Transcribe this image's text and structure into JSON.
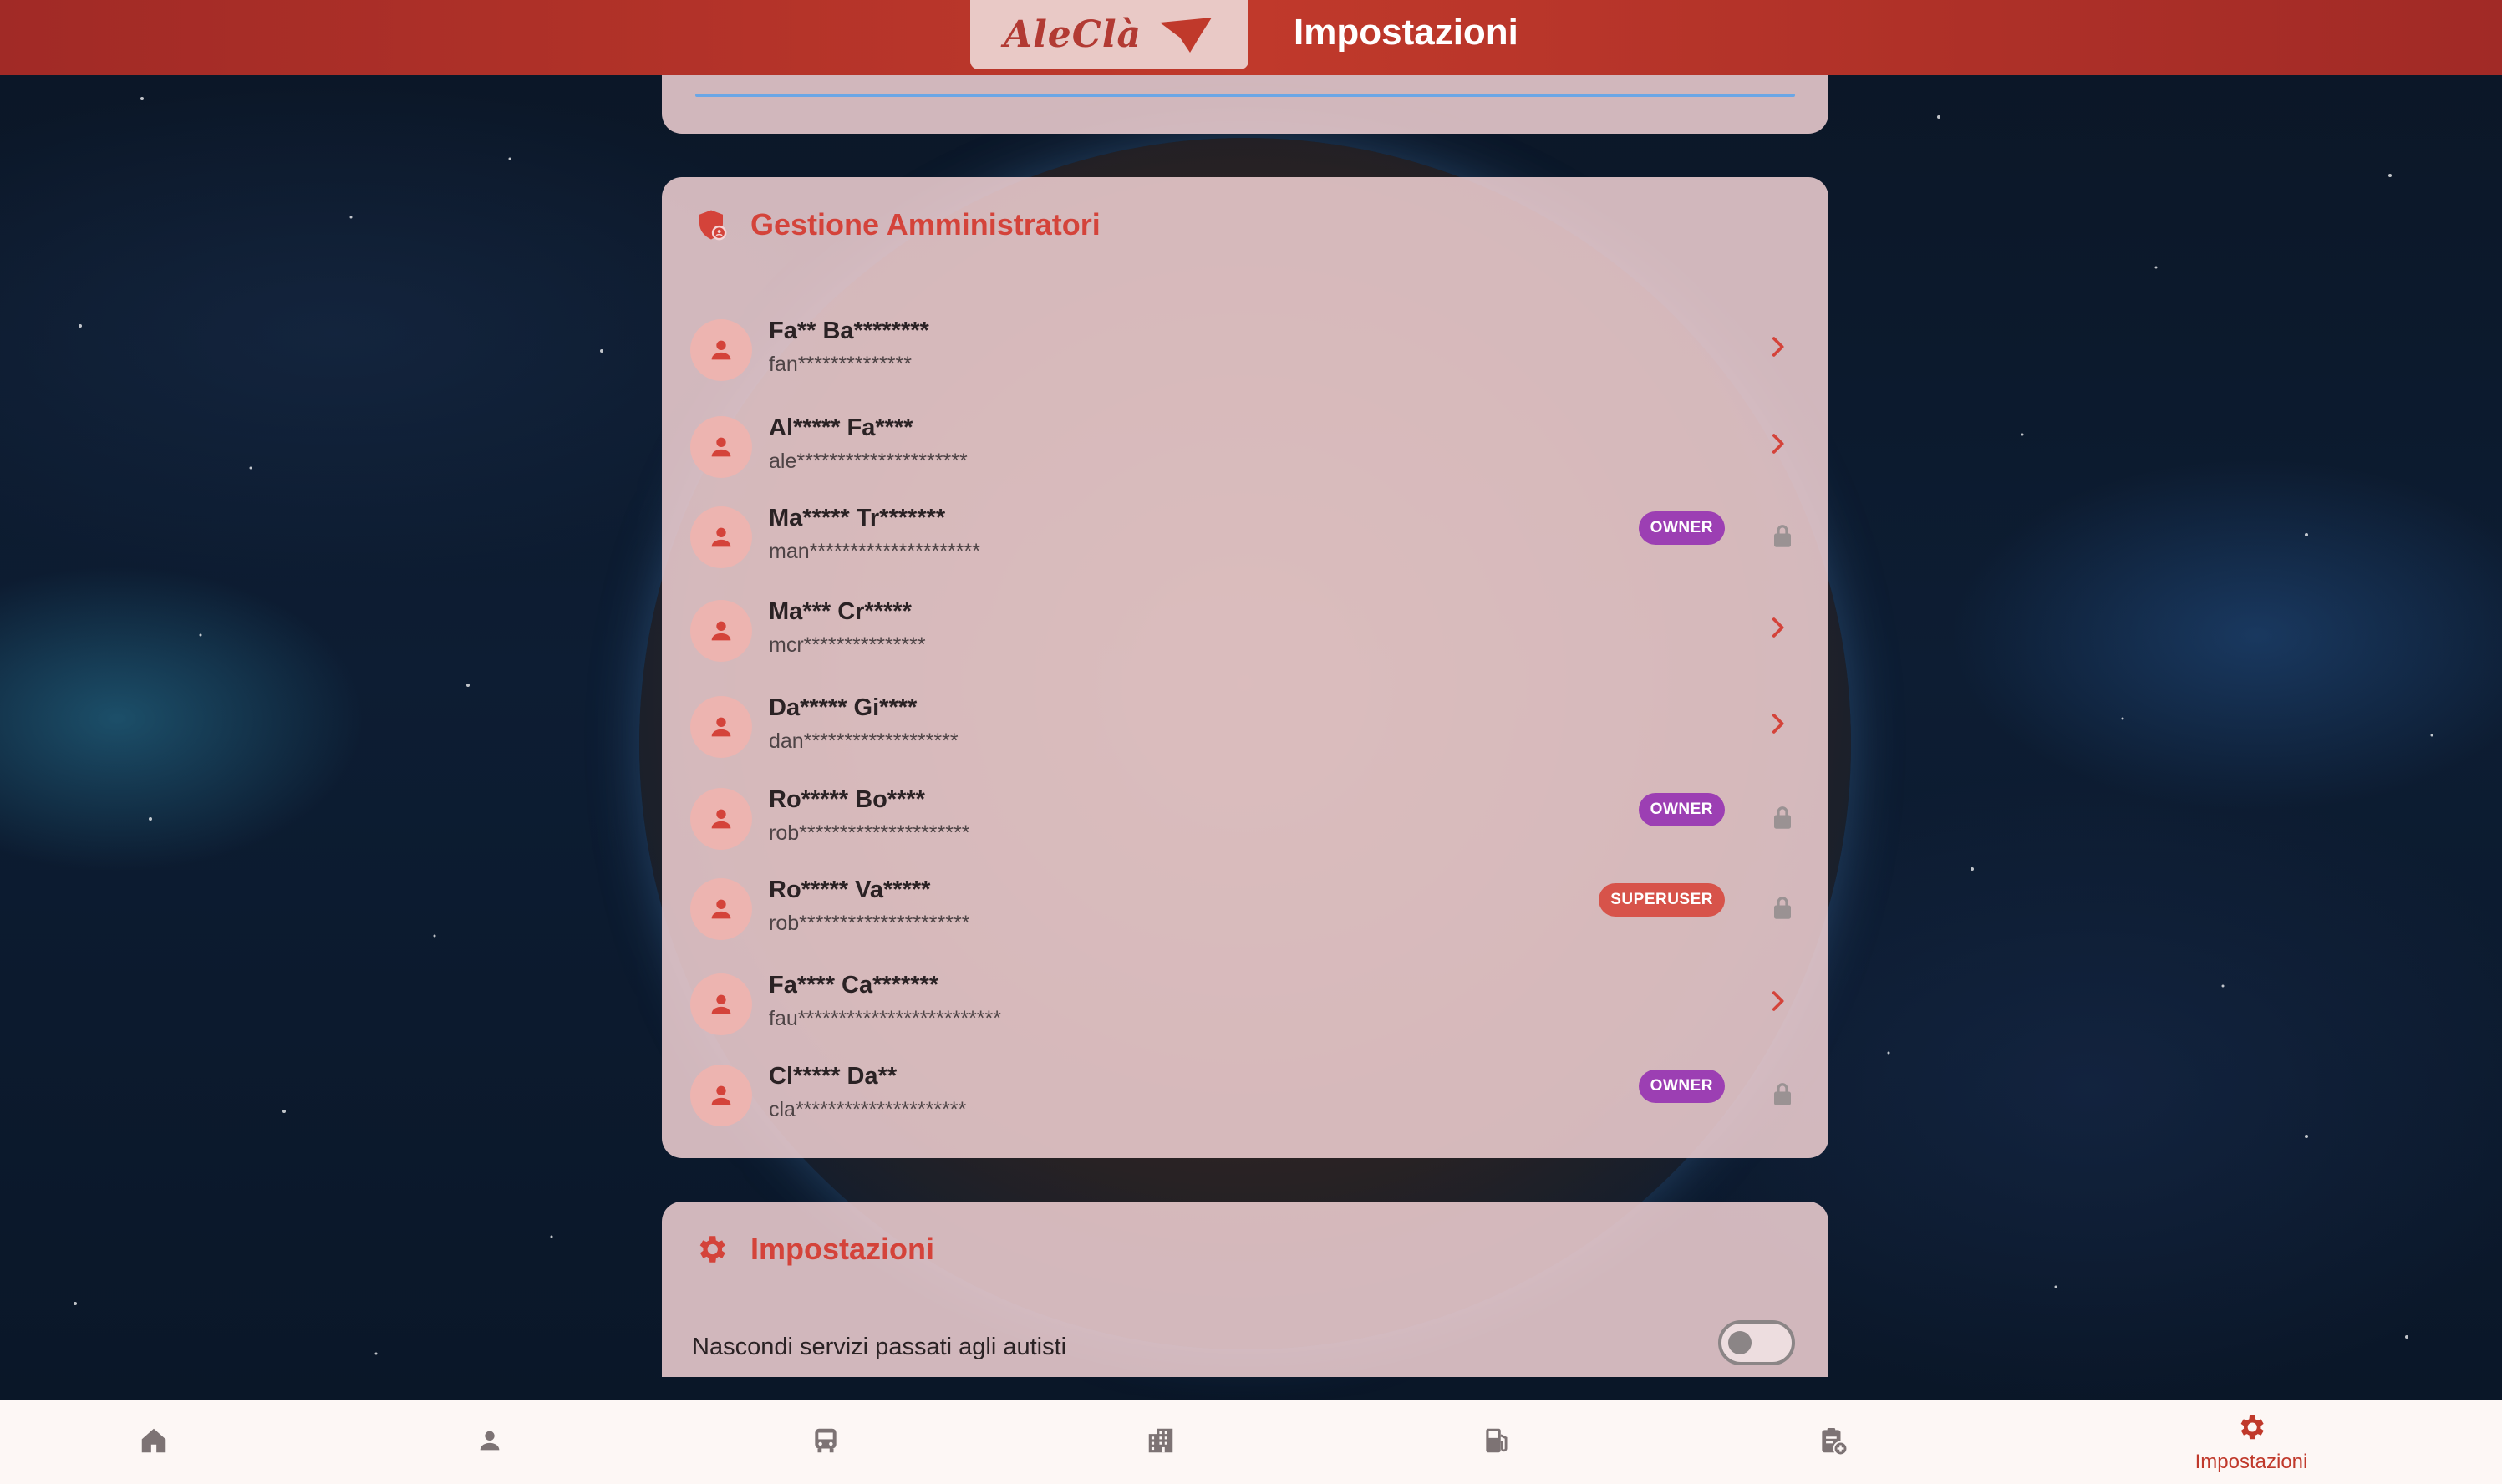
{
  "header": {
    "logo_text": "AleClà",
    "title": "Impostazioni"
  },
  "admins_section": {
    "title": "Gestione Amministratori",
    "icon": "admin-shield-icon",
    "items": [
      {
        "name": "Fa** Ba********",
        "email": "fan**************",
        "badge": "",
        "action": "chevron"
      },
      {
        "name": "Al***** Fa****",
        "email": "ale*********************",
        "badge": "",
        "action": "chevron"
      },
      {
        "name": "Ma***** Tr*******",
        "email": "man*********************",
        "badge": "OWNER",
        "action": "lock"
      },
      {
        "name": "Ma*** Cr*****",
        "email": "mcr***************",
        "badge": "",
        "action": "chevron"
      },
      {
        "name": "Da***** Gi****",
        "email": "dan*******************",
        "badge": "",
        "action": "chevron"
      },
      {
        "name": "Ro***** Bo****",
        "email": "rob*********************",
        "badge": "OWNER",
        "action": "lock"
      },
      {
        "name": "Ro***** Va*****",
        "email": "rob*********************",
        "badge": "SUPERUSER",
        "action": "lock"
      },
      {
        "name": "Fa**** Ca*******",
        "email": "fau*************************",
        "badge": "",
        "action": "chevron"
      },
      {
        "name": "Cl***** Da**",
        "email": "cla*********************",
        "badge": "OWNER",
        "action": "lock"
      }
    ]
  },
  "settings_section": {
    "title": "Impostazioni",
    "icon": "gear-icon",
    "toggle_label": "Nascondi servizi passati agli autisti",
    "toggle_value": false
  },
  "bottom_nav": {
    "items": [
      {
        "icon": "home-icon",
        "label": ""
      },
      {
        "icon": "person-icon",
        "label": ""
      },
      {
        "icon": "bus-icon",
        "label": ""
      },
      {
        "icon": "building-icon",
        "label": ""
      },
      {
        "icon": "fuel-icon",
        "label": ""
      },
      {
        "icon": "clipboard-add-icon",
        "label": ""
      },
      {
        "icon": "gear-icon",
        "label": "Impostazioni",
        "active": true
      }
    ]
  },
  "colors": {
    "brand_red": "#c0392b",
    "owner_badge": "#9c3fb3",
    "superuser_badge": "#d7534a"
  }
}
